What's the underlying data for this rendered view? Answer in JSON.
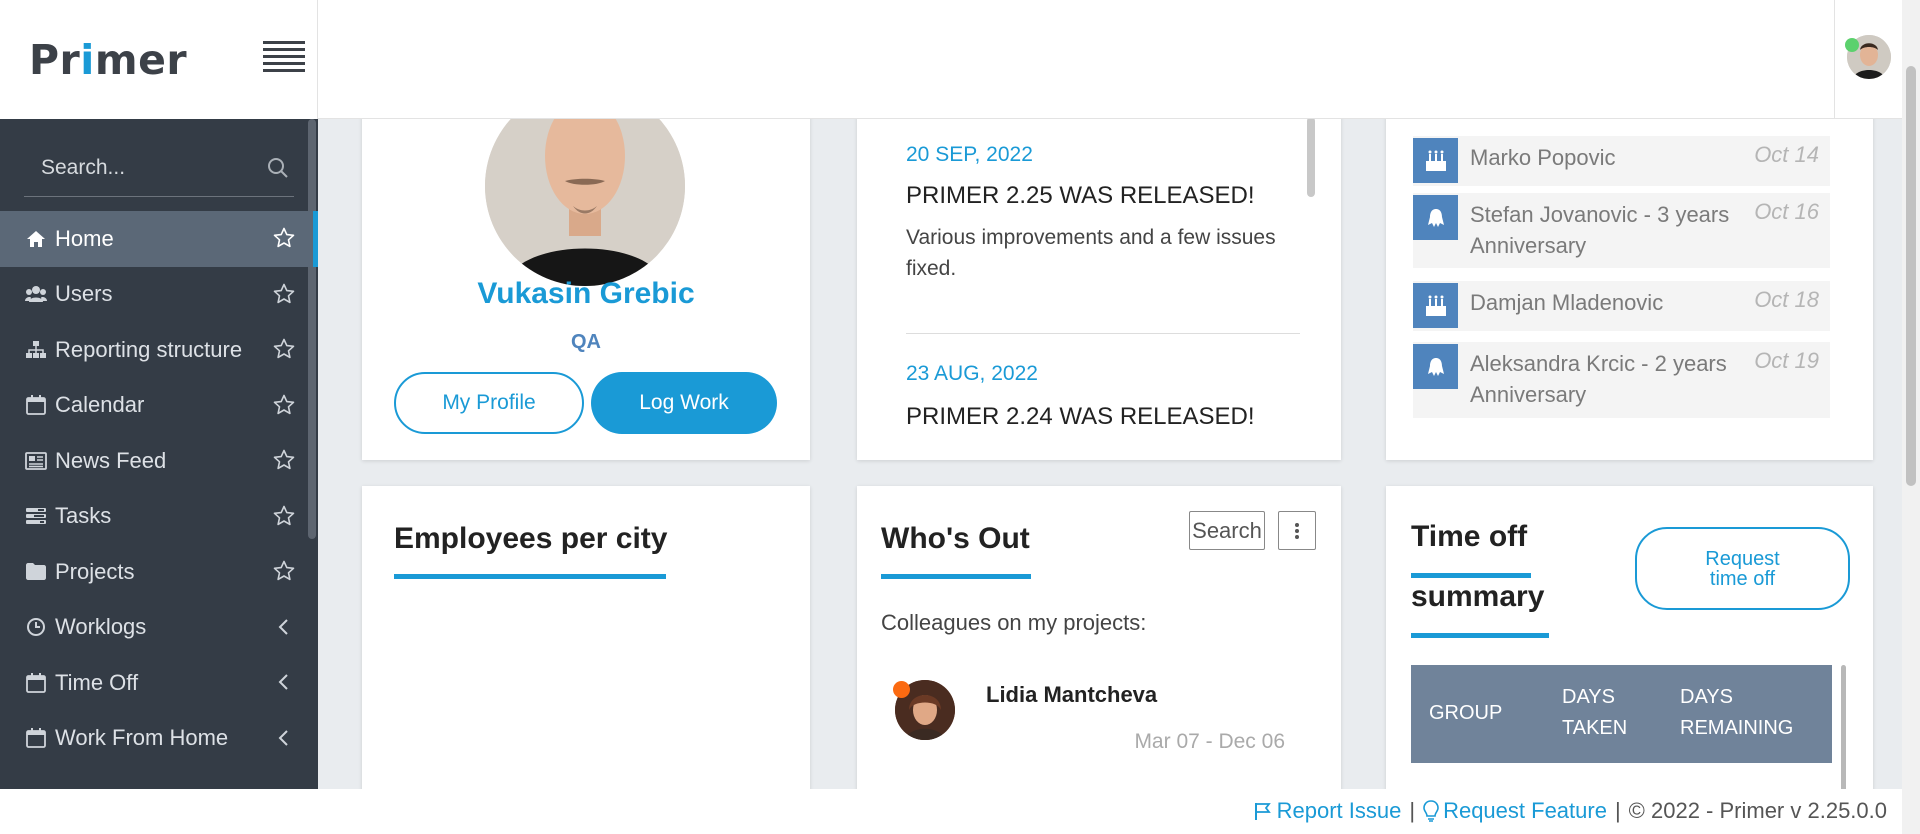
{
  "app": {
    "logo_pre": "Pr",
    "logo_i": "i",
    "logo_post": "mer"
  },
  "sidebar": {
    "search_placeholder": "Search...",
    "items": [
      {
        "label": "Home",
        "icon": "home-icon",
        "trail": "star"
      },
      {
        "label": "Users",
        "icon": "users-icon",
        "trail": "star"
      },
      {
        "label": "Reporting structure",
        "icon": "sitemap-icon",
        "trail": "star"
      },
      {
        "label": "Calendar",
        "icon": "calendar-icon",
        "trail": "star"
      },
      {
        "label": "News Feed",
        "icon": "newspaper-icon",
        "trail": "star"
      },
      {
        "label": "Tasks",
        "icon": "tasks-icon",
        "trail": "star"
      },
      {
        "label": "Projects",
        "icon": "folder-icon",
        "trail": "star"
      },
      {
        "label": "Worklogs",
        "icon": "clock-icon",
        "trail": "chevron"
      },
      {
        "label": "Time Off",
        "icon": "calendar-icon",
        "trail": "chevron"
      },
      {
        "label": "Work From Home",
        "icon": "calendar-icon",
        "trail": "chevron"
      }
    ]
  },
  "profile": {
    "name": "Vukasin Grebic",
    "role": "QA",
    "my_profile_label": "My Profile",
    "log_work_label": "Log Work"
  },
  "news": [
    {
      "date": "20 SEP, 2022",
      "title": "PRIMER 2.25 WAS RELEASED!",
      "body": "Various improvements and a few issues fixed."
    },
    {
      "date": "23 AUG, 2022",
      "title": "PRIMER 2.24 WAS RELEASED!"
    }
  ],
  "celebrations": [
    {
      "name": "Marko Popovic",
      "date": "Oct 14",
      "icon": "birthday-cake-icon"
    },
    {
      "name": "Stefan Jovanovic - 3 years Anniversary",
      "date": "Oct 16",
      "icon": "anniversary-icon"
    },
    {
      "name": "Damjan Mladenovic",
      "date": "Oct 18",
      "icon": "birthday-cake-icon"
    },
    {
      "name": "Aleksandra Krcic - 2 years Anniversary",
      "date": "Oct 19",
      "icon": "anniversary-icon"
    }
  ],
  "employees_per_city": {
    "title": "Employees per city"
  },
  "whos_out": {
    "title": "Who's Out",
    "search_label": "Search",
    "colleagues_label": "Colleagues on my projects:",
    "colleague": {
      "name": "Lidia Mantcheva",
      "dates": "Mar 07 - Dec 06"
    }
  },
  "time_off": {
    "title_line1": "Time off",
    "title_line2": "summary",
    "request_line1": "Request",
    "request_line2": "time off",
    "columns": [
      {
        "line1": "GROUP",
        "line2": ""
      },
      {
        "line1": "DAYS",
        "line2": "TAKEN"
      },
      {
        "line1": "DAYS",
        "line2": "REMAINING"
      }
    ]
  },
  "footer": {
    "report_issue": "Report Issue",
    "separator": "|",
    "request_feature": "Request Feature",
    "copyright": "© 2022 - Primer v 2.25.0.0"
  },
  "colors": {
    "accent": "#1a9ad6",
    "sidebar_bg": "#343c46",
    "active_item": "#5b6877",
    "table_header": "#70839a",
    "icon_bg": "#4f84bd"
  }
}
